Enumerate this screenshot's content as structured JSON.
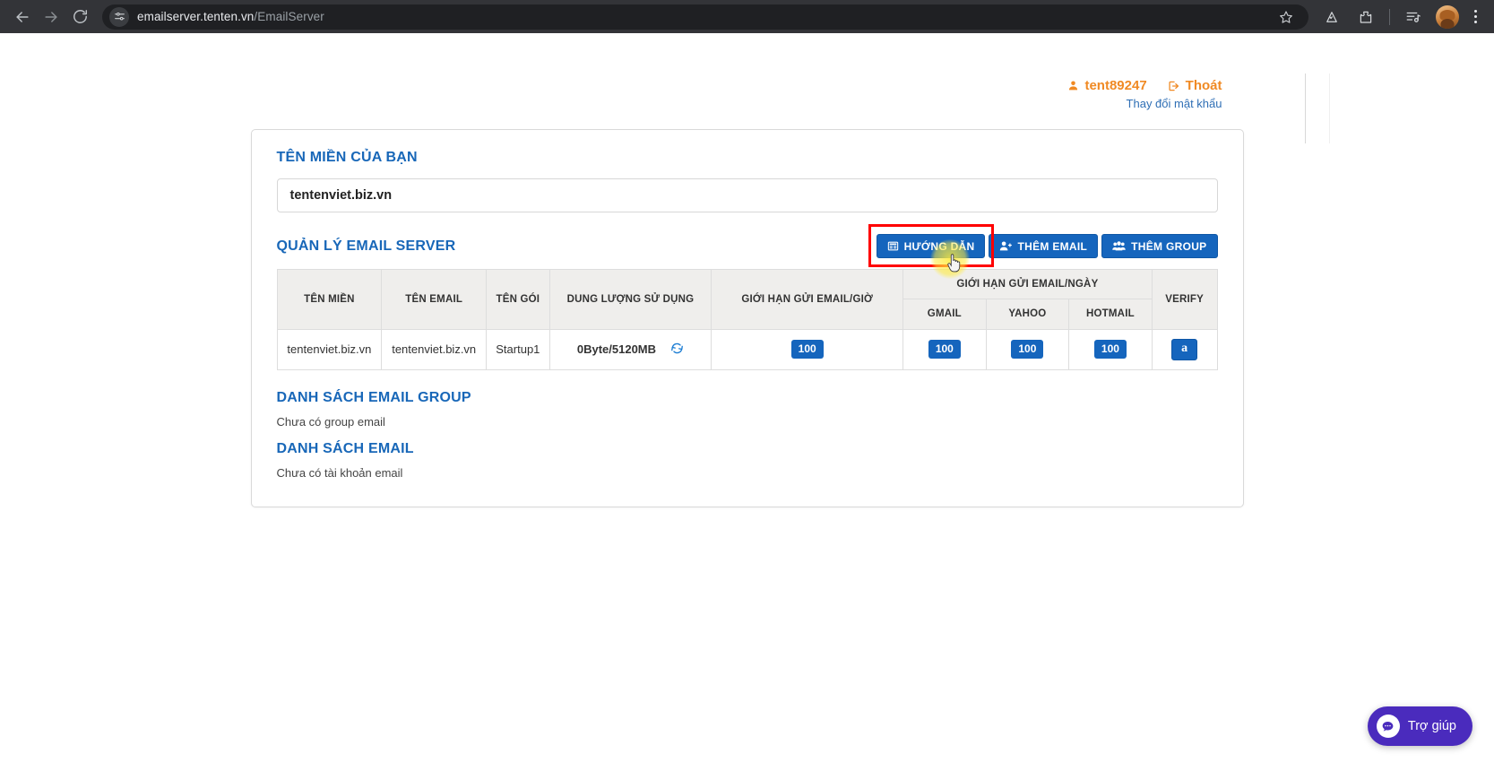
{
  "browser": {
    "back_icon": "back-arrow-icon",
    "forward_icon": "forward-arrow-icon",
    "reload_icon": "reload-icon",
    "site_info_icon": "site-settings-icon",
    "url_host": "emailserver.tenten.vn",
    "url_path": "/EmailServer",
    "bookmark_icon": "star-icon",
    "toolbar_icons": [
      "mountain-icon",
      "extensions-icon",
      "reading-list-icon",
      "profile-avatar",
      "chrome-menu-icon"
    ]
  },
  "account": {
    "username": "tent89247",
    "logout_label": "Thoát",
    "change_password_label": "Thay đổi mật khẩu",
    "user_icon": "user-icon",
    "logout_icon": "logout-icon",
    "accent_color": "#f08a24",
    "link_color": "#2f6fb5"
  },
  "domain_section": {
    "title": "TÊN MIỀN CỦA BẠN",
    "domain_value": "tentenviet.biz.vn"
  },
  "manager_section": {
    "title": "QUẢN LÝ EMAIL SERVER",
    "buttons": [
      {
        "label": "HƯỚNG DẪN",
        "icon": "guide-book-icon",
        "highlighted": true
      },
      {
        "label": "THÊM EMAIL",
        "icon": "add-user-icon",
        "highlighted": false
      },
      {
        "label": "THÊM GROUP",
        "icon": "add-group-icon",
        "highlighted": false
      }
    ],
    "highlight_color": "#ff0000",
    "button_color": "#1565bd"
  },
  "table": {
    "group_header": "GIỚI HẠN GỬI EMAIL/NGÀY",
    "headers": [
      "TÊN MIỀN",
      "TÊN EMAIL",
      "TÊN GÓI",
      "DUNG LƯỢNG SỬ DỤNG",
      "GIỚI HẠN GỬI EMAIL/GIỜ",
      "VERIFY"
    ],
    "sub_headers": [
      "GMAIL",
      "YAHOO",
      "HOTMAIL"
    ],
    "rows": [
      {
        "domain": "tentenviet.biz.vn",
        "email": "tentenviet.biz.vn",
        "package": "Startup1",
        "usage": "0Byte/5120MB",
        "refresh_icon": "refresh-icon",
        "limit_hour": "100",
        "gmail": "100",
        "yahoo": "100",
        "hotmail": "100",
        "verify_icon": "amazon-ses-icon"
      }
    ]
  },
  "group_list": {
    "title": "DANH SÁCH EMAIL GROUP",
    "empty_text": "Chưa có group email"
  },
  "email_list": {
    "title": "DANH SÁCH EMAIL",
    "empty_text": "Chưa có tài khoản email"
  },
  "chat_widget": {
    "label": "Trợ giúp",
    "icon": "chat-bubble-icon",
    "color": "#4a2bbd"
  }
}
